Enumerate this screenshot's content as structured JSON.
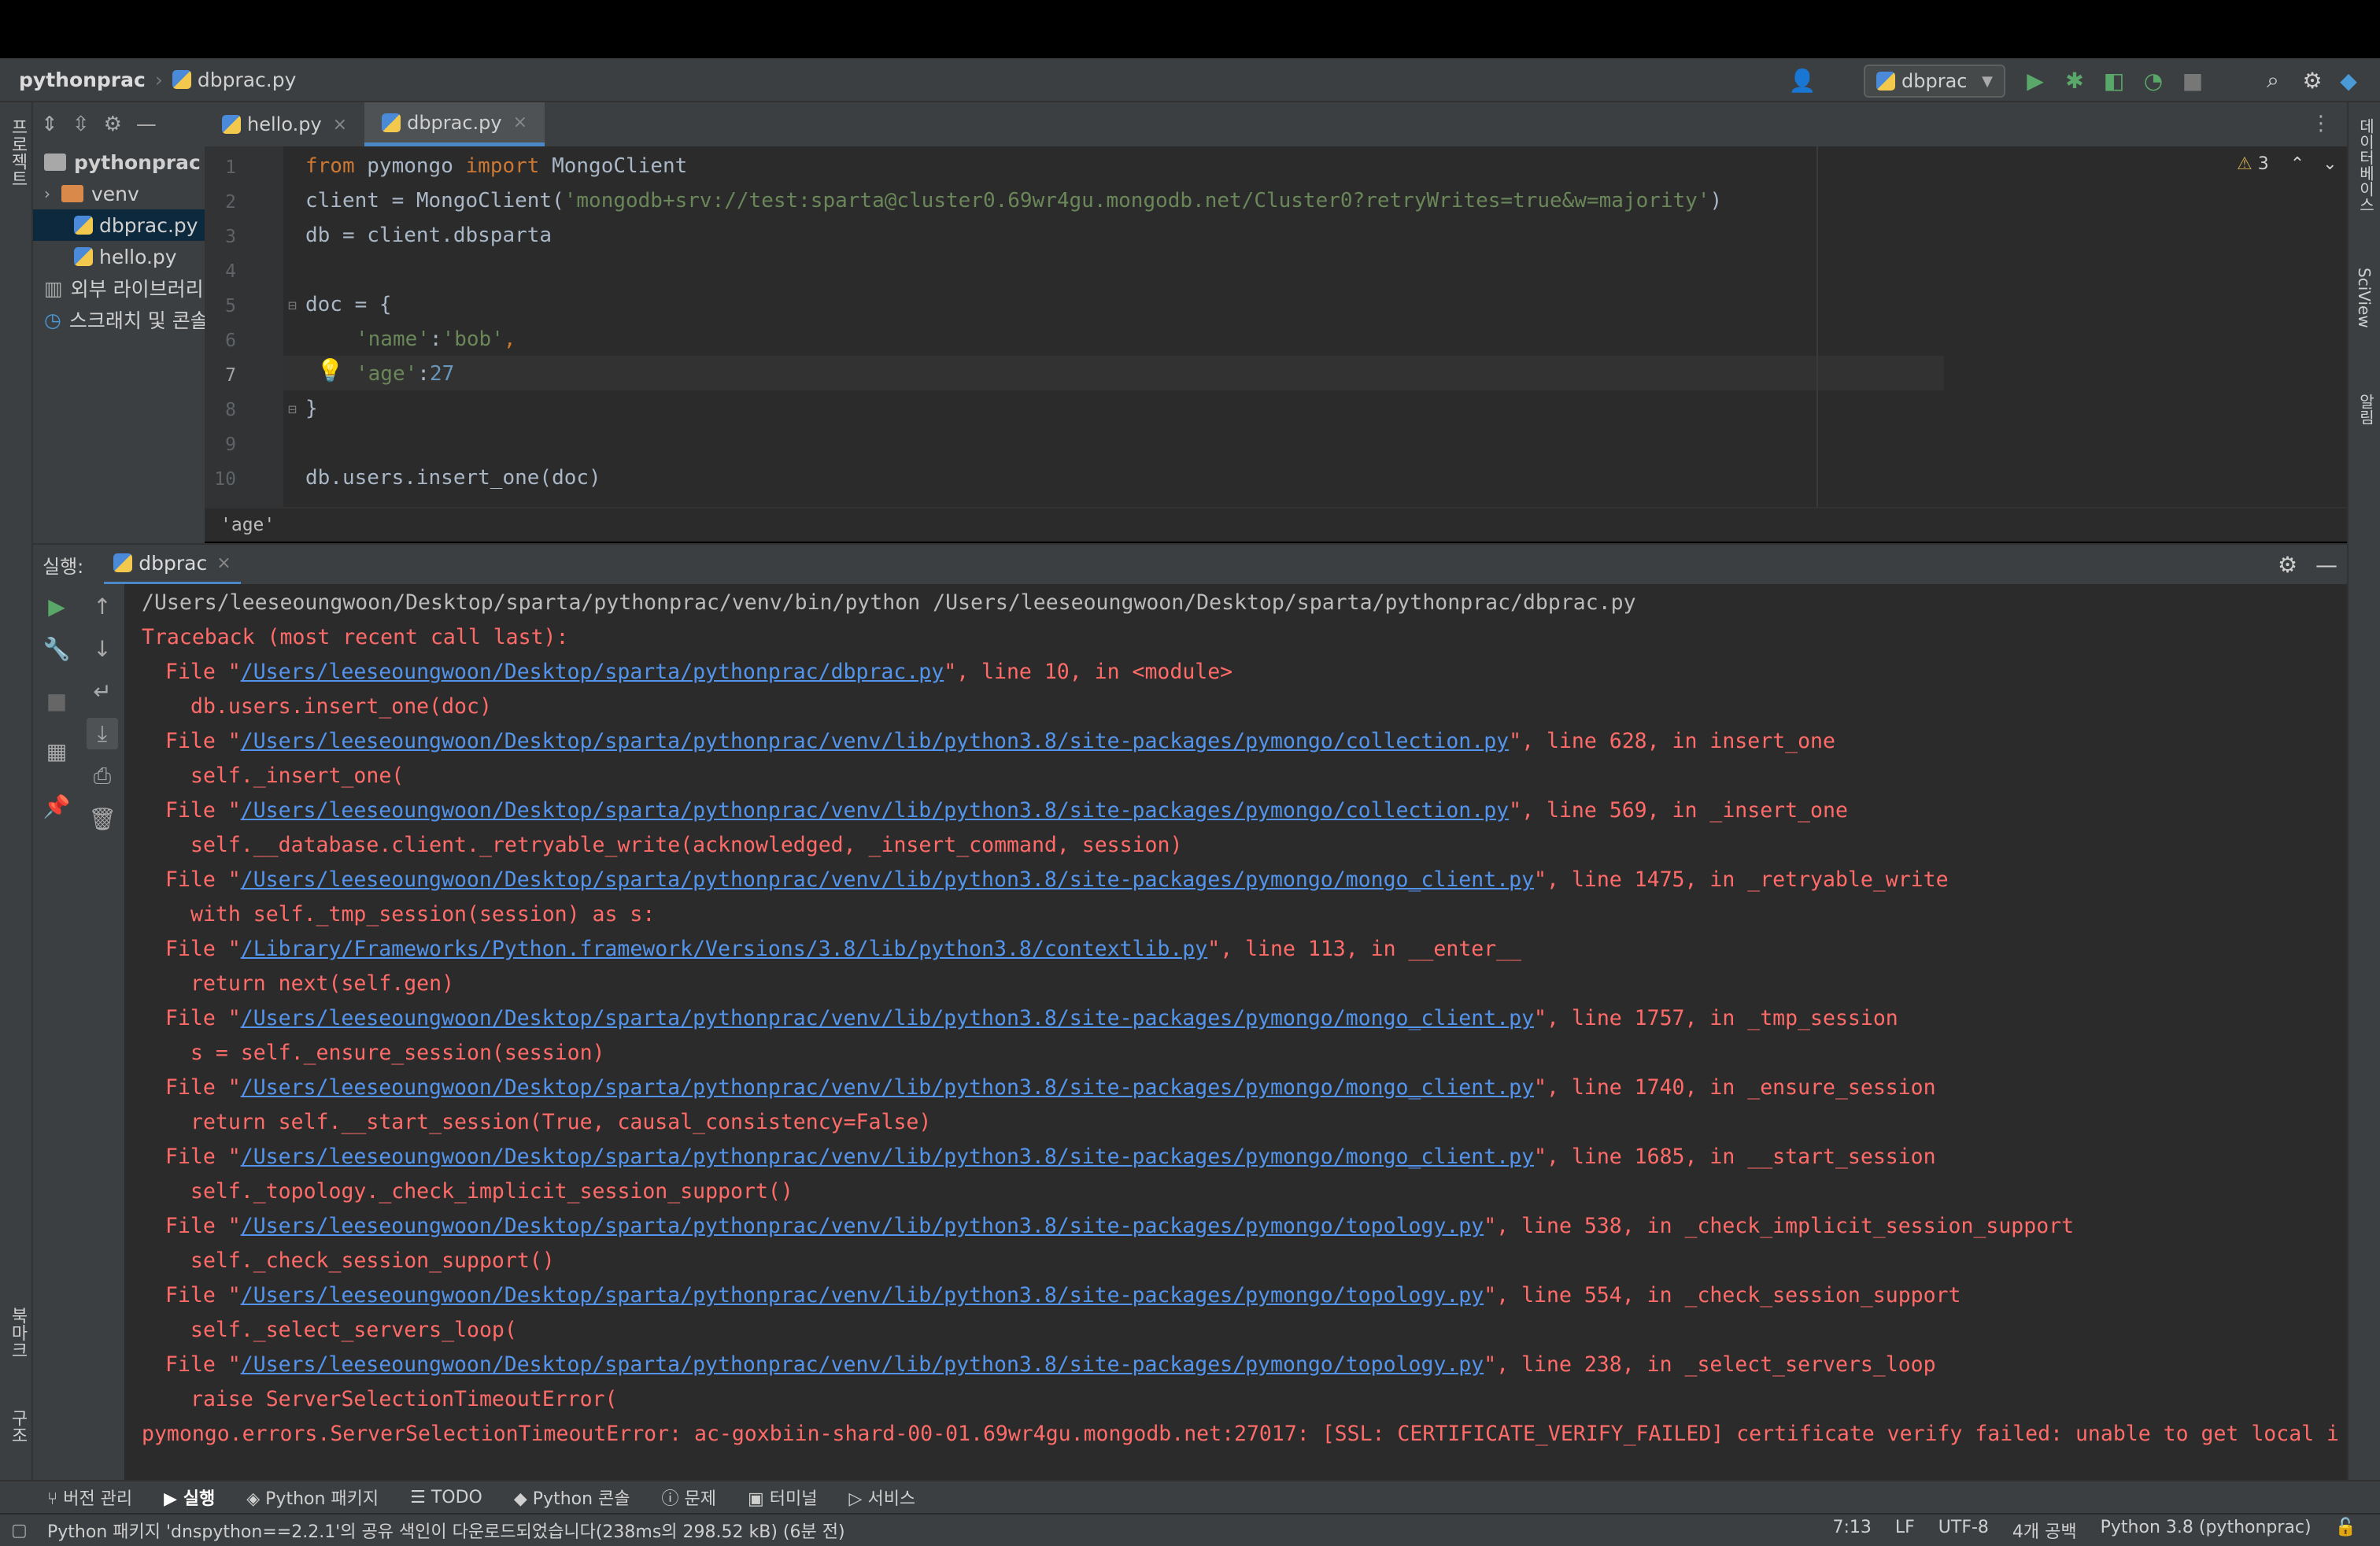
{
  "navbar": {
    "project": "pythonprac",
    "file": "dbprac.py",
    "run_config": "dbprac"
  },
  "left_strip": {
    "project_label": "프로젝트",
    "bookmarks_label": "북마크",
    "structure_label": "구조"
  },
  "right_strip": {
    "database_label": "데이터베이스",
    "sciview_label": "SciView",
    "notifications_label": "알림"
  },
  "project_tree": [
    {
      "label": "pythonprac",
      "type": "root"
    },
    {
      "label": "venv",
      "type": "folder"
    },
    {
      "label": "dbprac.py",
      "type": "file"
    },
    {
      "label": "hello.py",
      "type": "file"
    },
    {
      "label": "외부 라이브러리",
      "type": "lib"
    },
    {
      "label": "스크래치 및 콘솔",
      "type": "scratch"
    }
  ],
  "editor": {
    "tabs": [
      {
        "label": "hello.py"
      },
      {
        "label": "dbprac.py"
      }
    ],
    "warnings": "3",
    "line_numbers": [
      "1",
      "2",
      "3",
      "4",
      "5",
      "6",
      "7",
      "8",
      "9",
      "10"
    ],
    "lines": {
      "l1_kw1": "from",
      "l1_mod": " pymongo ",
      "l1_kw2": "import",
      "l1_rest": " MongoClient",
      "l2_a": "client = MongoClient(",
      "l2_str": "'mongodb+srv://test:sparta@cluster0.69wr4gu.mongodb.net/Cluster0?retryWrites=true&w=majority'",
      "l2_b": ")",
      "l3": "db = client.dbsparta",
      "l5": "doc = {",
      "l6_str1": "'name'",
      "l6_mid": ":",
      "l6_str2": "'bob'",
      "l6_end": ",",
      "l7_str": "'age'",
      "l7_mid": ":",
      "l7_num": "27",
      "l8": "}",
      "l10": "db.users.insert_one(doc)"
    },
    "breadcrumb": "'age'"
  },
  "run": {
    "label": "실행:",
    "tab": "dbprac",
    "command": "/Users/leeseoungwoon/Desktop/sparta/pythonprac/venv/bin/python /Users/leeseoungwoon/Desktop/sparta/pythonprac/dbprac.py",
    "traceback_header": "Traceback (most recent call last):",
    "frames": [
      {
        "path": "/Users/leeseoungwoon/Desktop/sparta/pythonprac/dbprac.py",
        "tail": "\", line 10, in <module>",
        "code": "db.users.insert_one(doc)"
      },
      {
        "path": "/Users/leeseoungwoon/Desktop/sparta/pythonprac/venv/lib/python3.8/site-packages/pymongo/collection.py",
        "tail": "\", line 628, in insert_one",
        "code": "self._insert_one("
      },
      {
        "path": "/Users/leeseoungwoon/Desktop/sparta/pythonprac/venv/lib/python3.8/site-packages/pymongo/collection.py",
        "tail": "\", line 569, in _insert_one",
        "code": "self.__database.client._retryable_write(acknowledged, _insert_command, session)"
      },
      {
        "path": "/Users/leeseoungwoon/Desktop/sparta/pythonprac/venv/lib/python3.8/site-packages/pymongo/mongo_client.py",
        "tail": "\", line 1475, in _retryable_write",
        "code": "with self._tmp_session(session) as s:"
      },
      {
        "path": "/Library/Frameworks/Python.framework/Versions/3.8/lib/python3.8/contextlib.py",
        "tail": "\", line 113, in __enter__",
        "code": "return next(self.gen)"
      },
      {
        "path": "/Users/leeseoungwoon/Desktop/sparta/pythonprac/venv/lib/python3.8/site-packages/pymongo/mongo_client.py",
        "tail": "\", line 1757, in _tmp_session",
        "code": "s = self._ensure_session(session)"
      },
      {
        "path": "/Users/leeseoungwoon/Desktop/sparta/pythonprac/venv/lib/python3.8/site-packages/pymongo/mongo_client.py",
        "tail": "\", line 1740, in _ensure_session",
        "code": "return self.__start_session(True, causal_consistency=False)"
      },
      {
        "path": "/Users/leeseoungwoon/Desktop/sparta/pythonprac/venv/lib/python3.8/site-packages/pymongo/mongo_client.py",
        "tail": "\", line 1685, in __start_session",
        "code": "self._topology._check_implicit_session_support()"
      },
      {
        "path": "/Users/leeseoungwoon/Desktop/sparta/pythonprac/venv/lib/python3.8/site-packages/pymongo/topology.py",
        "tail": "\", line 538, in _check_implicit_session_support",
        "code": "self._check_session_support()"
      },
      {
        "path": "/Users/leeseoungwoon/Desktop/sparta/pythonprac/venv/lib/python3.8/site-packages/pymongo/topology.py",
        "tail": "\", line 554, in _check_session_support",
        "code": "self._select_servers_loop("
      },
      {
        "path": "/Users/leeseoungwoon/Desktop/sparta/pythonprac/venv/lib/python3.8/site-packages/pymongo/topology.py",
        "tail": "\", line 238, in _select_servers_loop",
        "code": "raise ServerSelectionTimeoutError("
      }
    ],
    "error": "pymongo.errors.ServerSelectionTimeoutError: ac-goxbiin-shard-00-01.69wr4gu.mongodb.net:27017: [SSL: CERTIFICATE_VERIFY_FAILED] certificate verify failed: unable to get local i"
  },
  "bottom_tools": [
    "버전 관리",
    "실행",
    "Python 패키지",
    "TODO",
    "Python 콘솔",
    "문제",
    "터미널",
    "서비스"
  ],
  "status": {
    "message": "Python 패키지 'dnspython==2.2.1'의 공유 색인이 다운로드되었습니다(238ms의 298.52 kB) (6분 전)",
    "position": "7:13",
    "line_sep": "LF",
    "encoding": "UTF-8",
    "indent": "4개 공백",
    "interpreter": "Python 3.8 (pythonprac)"
  },
  "colors": {
    "accent": "#4a88c7",
    "error": "#ff6b68",
    "link": "#5394ec",
    "run_green": "#59a869"
  }
}
